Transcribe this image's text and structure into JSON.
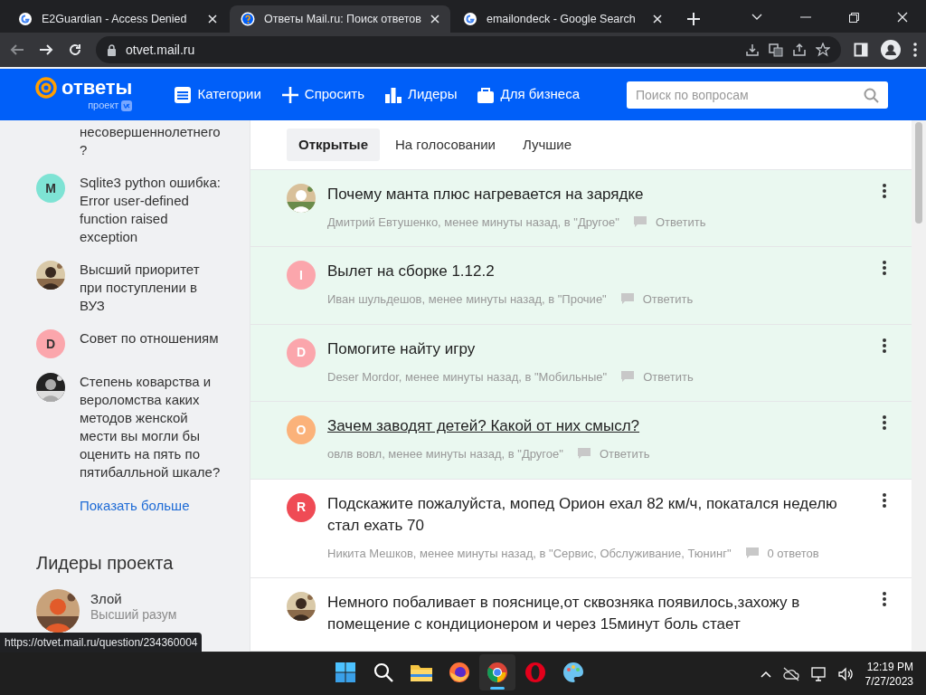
{
  "browser": {
    "tabs": [
      {
        "title": "E2Guardian - Access Denied",
        "selected": false
      },
      {
        "title": "Ответы Mail.ru: Поиск ответов",
        "selected": true
      },
      {
        "title": "emailondeck - Google Search",
        "selected": false
      }
    ],
    "address": "otvet.mail.ru",
    "status_url": "https://otvet.mail.ru/question/234360004"
  },
  "header": {
    "logo": "ответы",
    "logo_sub": "проект",
    "nav": [
      {
        "label": "Категории"
      },
      {
        "label": "Спросить"
      },
      {
        "label": "Лидеры"
      },
      {
        "label": "Для бизнеса"
      }
    ],
    "search": {
      "placeholder": "Поиск по вопросам"
    }
  },
  "sidebar": {
    "questions": [
      {
        "text": "несовершеннолетнего ?",
        "avatar": {
          "kind": "none"
        }
      },
      {
        "text": "Sqlite3 python ошибка: Error user-defined function raised exception",
        "avatar": {
          "kind": "letter",
          "letter": "M",
          "color": "#7ee3d4"
        }
      },
      {
        "text": "Высший приоритет при поступлении в ВУЗ"
      },
      {
        "text": "Совет по отношениям",
        "avatar": {
          "kind": "letter",
          "letter": "D",
          "color": "#fba6ac"
        }
      },
      {
        "text": "Степень коварства и вероломства каких методов женской мести вы могли бы оценить на пять по пятибалльной шкале?"
      }
    ],
    "show_more": "Показать больше",
    "leaders_title": "Лидеры проекта",
    "leaders": [
      {
        "name": "Злой",
        "rank": "Высший разум"
      }
    ]
  },
  "filters": [
    {
      "label": "Открытые",
      "selected": true
    },
    {
      "label": "На голосовании",
      "selected": false
    },
    {
      "label": "Лучшие",
      "selected": false
    }
  ],
  "questions": [
    {
      "title": "Почему манта плюс нагревается на зарядке",
      "meta": "Дмитрий Евтушенко, менее минуты назад, в \"Другое\"",
      "action": "Ответить",
      "highlighted": true,
      "hovered": false
    },
    {
      "title": "Вылет на сборке 1.12.2",
      "meta": "Иван шульдешов, менее минуты назад, в \"Прочие\"",
      "action": "Ответить",
      "avatar": {
        "kind": "letter",
        "letter": "I",
        "color": "#fba6ac"
      },
      "highlighted": true,
      "hovered": false
    },
    {
      "title": "Помогите найту игру",
      "meta": "Deser Mordor, менее минуты назад, в \"Мобильные\"",
      "action": "Ответить",
      "avatar": {
        "kind": "letter",
        "letter": "D",
        "color": "#fba6ac"
      },
      "highlighted": true,
      "hovered": false
    },
    {
      "title": "Зачем заводят детей? Какой от них смысл?",
      "meta": "овлв вовл, менее минуты назад, в \"Другое\"",
      "action": "Ответить",
      "avatar": {
        "kind": "letter",
        "letter": "O",
        "color": "#fbb27a"
      },
      "highlighted": true,
      "hovered": true
    },
    {
      "title": "Подскажите пожалуйста, мопед Орион ехал 82 км/ч, покатался неделю стал ехать 70",
      "meta": "Никита Мешков, менее минуты назад, в \"Сервис, Обслуживание, Тюнинг\"",
      "action": "0 ответов",
      "avatar": {
        "kind": "letter",
        "letter": "R",
        "color": "#ef4b55"
      },
      "highlighted": false,
      "hovered": false
    },
    {
      "title": "Немного побаливает в пояснице,от сквозняка появилось,захожу в помещение с кондиционером и через 15минут боль стает",
      "highlighted": false,
      "hovered": false
    }
  ],
  "taskbar": {
    "apps": [
      {
        "active": false
      },
      {
        "active": false
      },
      {
        "active": false
      },
      {
        "active": false
      },
      {
        "active": true
      },
      {
        "active": false
      },
      {
        "active": false
      }
    ],
    "time": "12:19 PM",
    "date": "7/27/2023"
  }
}
